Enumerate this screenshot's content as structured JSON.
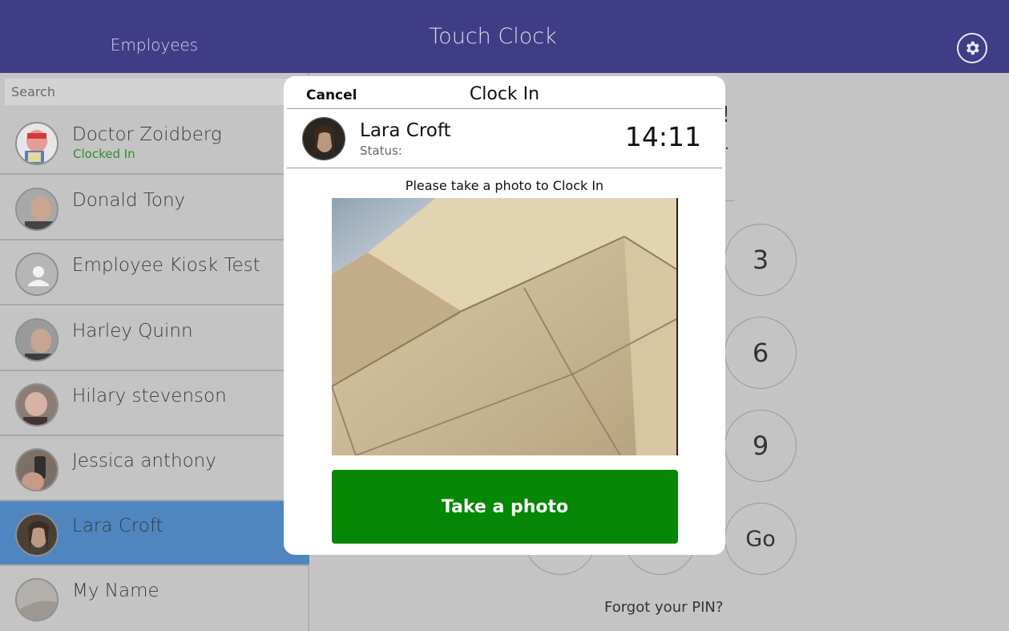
{
  "header": {
    "employees_label": "Employees",
    "app_title": "Touch Clock",
    "settings_icon": "gear-icon"
  },
  "search": {
    "placeholder": "Search",
    "value": ""
  },
  "employees": [
    {
      "name": "Doctor Zoidberg",
      "status": "Clocked In",
      "selected": false
    },
    {
      "name": "Donald Tony",
      "status": "",
      "selected": false
    },
    {
      "name": "Employee Kiosk Test",
      "status": "",
      "selected": false
    },
    {
      "name": "Harley Quinn",
      "status": "",
      "selected": false
    },
    {
      "name": "Hilary stevenson",
      "status": "",
      "selected": false
    },
    {
      "name": "Jessica anthony",
      "status": "",
      "selected": false
    },
    {
      "name": "Lara Croft",
      "status": "",
      "selected": true
    },
    {
      "name": "My Name",
      "status": "",
      "selected": false
    }
  ],
  "keypad": {
    "keys": [
      "3",
      "6",
      "9",
      "Go"
    ],
    "forgot_pin": "Forgot your PIN?"
  },
  "modal": {
    "cancel_label": "Cancel",
    "title": "Clock In",
    "employee_name": "Lara Croft",
    "status_label": "Status:",
    "time": "14:11",
    "instruction": "Please take a photo to Clock In",
    "take_photo_label": "Take a photo"
  },
  "colors": {
    "header_bg": "#3f3d86",
    "selected_row": "#4f86c0",
    "clocked_in": "#2e8f2e",
    "take_photo_button": "#068706"
  }
}
